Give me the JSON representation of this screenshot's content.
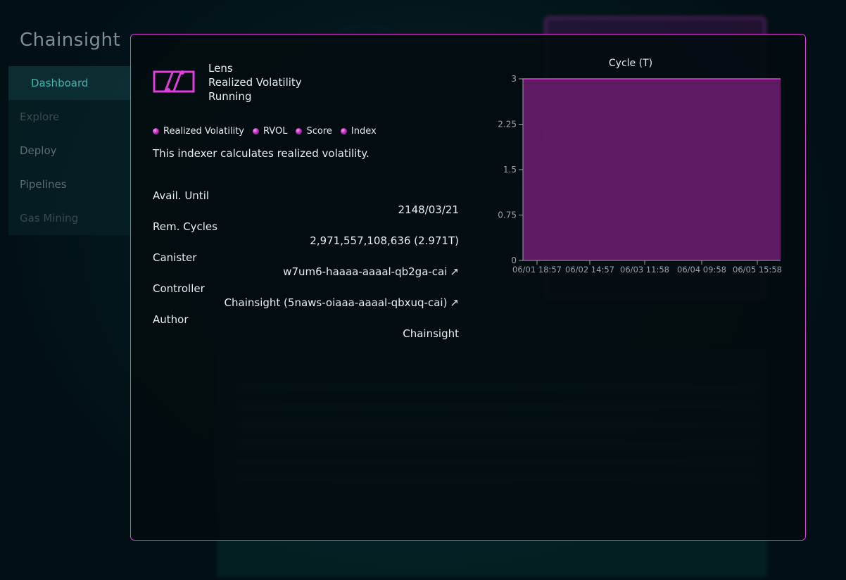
{
  "brand": "Chainsight",
  "sidebar": {
    "items": [
      {
        "label": "Dashboard"
      },
      {
        "label": "Explore"
      },
      {
        "label": "Deploy"
      },
      {
        "label": "Pipelines"
      },
      {
        "label": "Gas Mining"
      }
    ]
  },
  "modal": {
    "type": "Lens",
    "name": "Realized Volatility",
    "status": "Running",
    "tags": [
      "Realized Volatility",
      "RVOL",
      "Score",
      "Index"
    ],
    "description": "This indexer calculates realized volatility.",
    "fields": [
      {
        "label": "Avail. Until",
        "value": "2148/03/21"
      },
      {
        "label": "Rem. Cycles",
        "value": "2,971,557,108,636 (2.971T)"
      },
      {
        "label": "Canister",
        "value": "w7um6-haaaa-aaaal-qb2ga-cai"
      },
      {
        "label": "Controller",
        "value": "Chainsight (5naws-oiaaa-aaaal-qbxuq-cai)"
      },
      {
        "label": "Author",
        "value": "Chainsight"
      }
    ],
    "link_arrow": "↗"
  },
  "colors": {
    "accent": "#e23ddb",
    "fill": "#6e1f73",
    "teal": "#3fb6a8"
  },
  "chart_data": {
    "type": "area",
    "title": "Cycle (T)",
    "x": [
      "06/01 18:57",
      "06/02 14:57",
      "06/03 11:58",
      "06/04 09:58",
      "06/05 15:58"
    ],
    "series": [
      {
        "values": [
          3,
          3,
          3,
          3,
          3
        ]
      }
    ],
    "y_ticks": [
      "0",
      "0.75",
      "1.5",
      "2.25",
      "3"
    ],
    "ylim": [
      0,
      3
    ],
    "grid": false
  }
}
